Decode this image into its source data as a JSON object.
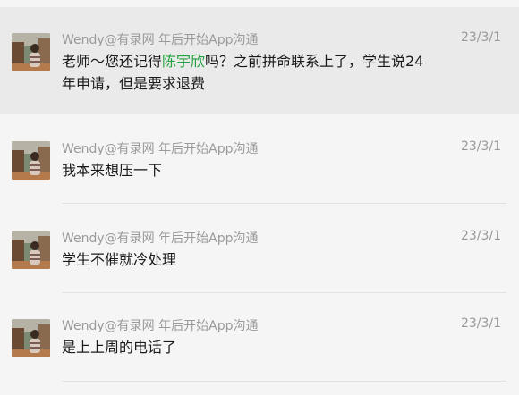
{
  "messages": [
    {
      "sender": "Wendy@有录网 年后开始App沟通",
      "date": "23/3/1",
      "text_before": "老师～您还记得",
      "text_highlight": "陈宇欣",
      "text_after": "吗？之前拼命联系上了，学生说24年申请，但是要求退费"
    },
    {
      "sender": "Wendy@有录网 年后开始App沟通",
      "date": "23/3/1",
      "text": "我本来想压一下"
    },
    {
      "sender": "Wendy@有录网 年后开始App沟通",
      "date": "23/3/1",
      "text": "学生不催就冷处理"
    },
    {
      "sender": "Wendy@有录网 年后开始App沟通",
      "date": "23/3/1",
      "text": "是上上周的电话了"
    }
  ],
  "colors": {
    "highlight_text": "#21a23c",
    "selected_row_bg": "#eaeaea"
  },
  "icons": [
    "avatar-photo"
  ]
}
